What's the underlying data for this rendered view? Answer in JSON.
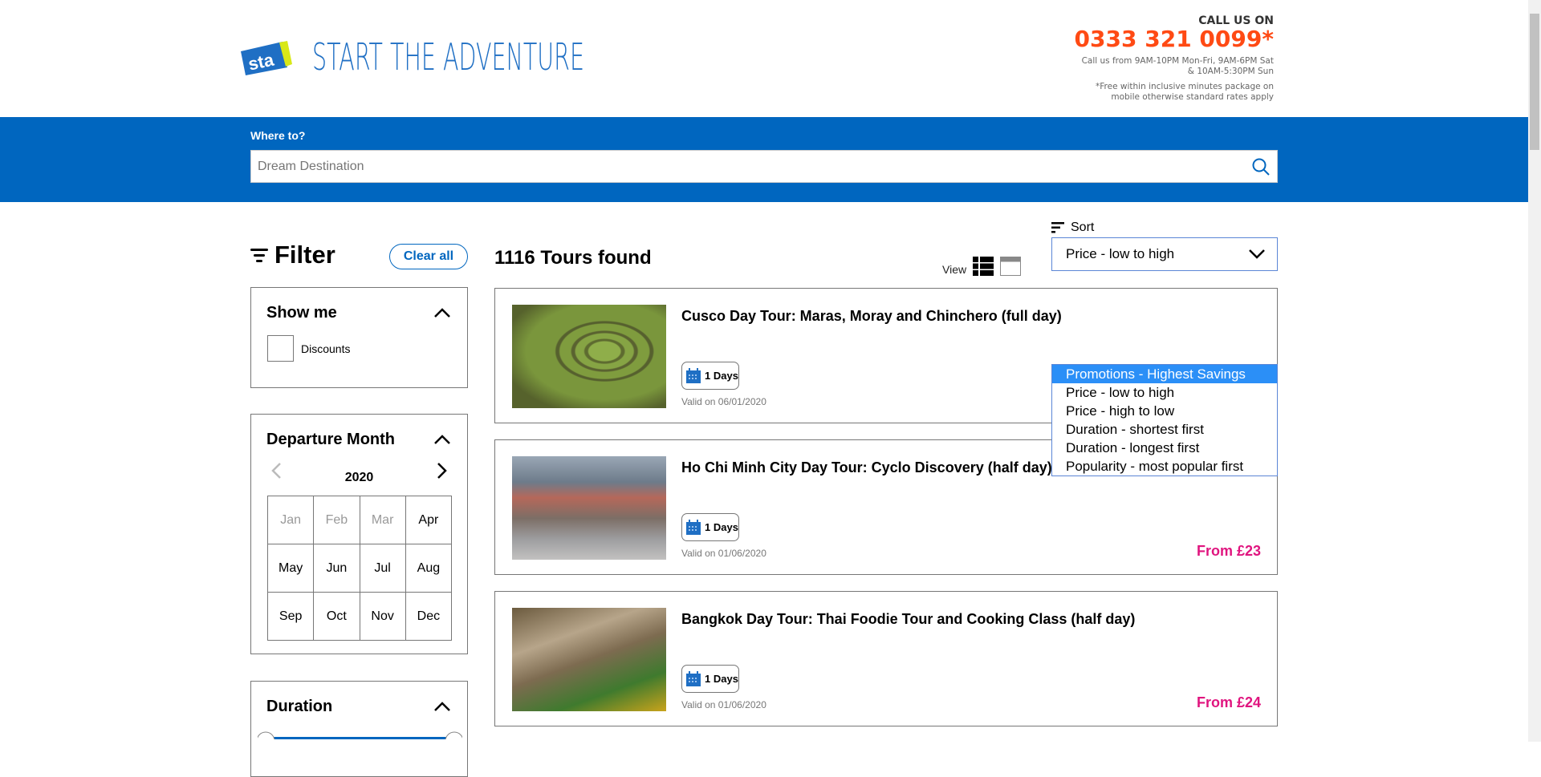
{
  "header": {
    "logo_text": "sta travel",
    "tagline": "START THE ADVENTURE",
    "call_label": "CALL US ON",
    "phone": "0333 321 0099*",
    "hours_line1": "Call us from 9AM-10PM Mon-Fri, 9AM-6PM Sat",
    "hours_line2": "& 10AM-5:30PM Sun",
    "note_line1": "*Free within inclusive minutes package on",
    "note_line2": "mobile otherwise standard rates apply"
  },
  "search": {
    "label": "Where to?",
    "placeholder": "Dream Destination",
    "value": ""
  },
  "filter": {
    "title": "Filter",
    "clear_label": "Clear all",
    "show_me": {
      "title": "Show me",
      "option": "Discounts",
      "checked": false
    },
    "departure": {
      "title": "Departure Month",
      "year": "2020",
      "months": [
        {
          "label": "Jan",
          "disabled": true
        },
        {
          "label": "Feb",
          "disabled": true
        },
        {
          "label": "Mar",
          "disabled": true
        },
        {
          "label": "Apr",
          "disabled": false
        },
        {
          "label": "May",
          "disabled": false
        },
        {
          "label": "Jun",
          "disabled": false
        },
        {
          "label": "Jul",
          "disabled": false
        },
        {
          "label": "Aug",
          "disabled": false
        },
        {
          "label": "Sep",
          "disabled": false
        },
        {
          "label": "Oct",
          "disabled": false
        },
        {
          "label": "Nov",
          "disabled": false
        },
        {
          "label": "Dec",
          "disabled": false
        }
      ]
    },
    "duration": {
      "title": "Duration"
    }
  },
  "results": {
    "count_text": "1116 Tours found",
    "view_label": "View",
    "sort_label": "Sort",
    "sort_selected": "Price - low to high",
    "sort_options": [
      "Promotions - Highest Savings",
      "Price - low to high",
      "Price - high to low",
      "Duration - shortest first",
      "Duration - longest first",
      "Popularity - most popular first"
    ],
    "sort_highlighted": "Promotions - Highest Savings",
    "tours": [
      {
        "title": "Cusco Day Tour: Maras, Moray and Chinchero (full day)",
        "days": "1 Days",
        "valid": "Valid on 06/01/2020",
        "price": ""
      },
      {
        "title": "Ho Chi Minh City Day Tour: Cyclo Discovery (half day)",
        "days": "1 Days",
        "valid": "Valid on 01/06/2020",
        "price": "From £23"
      },
      {
        "title": "Bangkok Day Tour: Thai Foodie Tour and Cooking Class (half day)",
        "days": "1 Days",
        "valid": "Valid on 01/06/2020",
        "price": "From £24"
      }
    ]
  },
  "colors": {
    "brand_blue": "#0066bf",
    "phone_orange": "#ff4a14",
    "price_pink": "#e0157f",
    "highlight": "#2b8ff7"
  }
}
